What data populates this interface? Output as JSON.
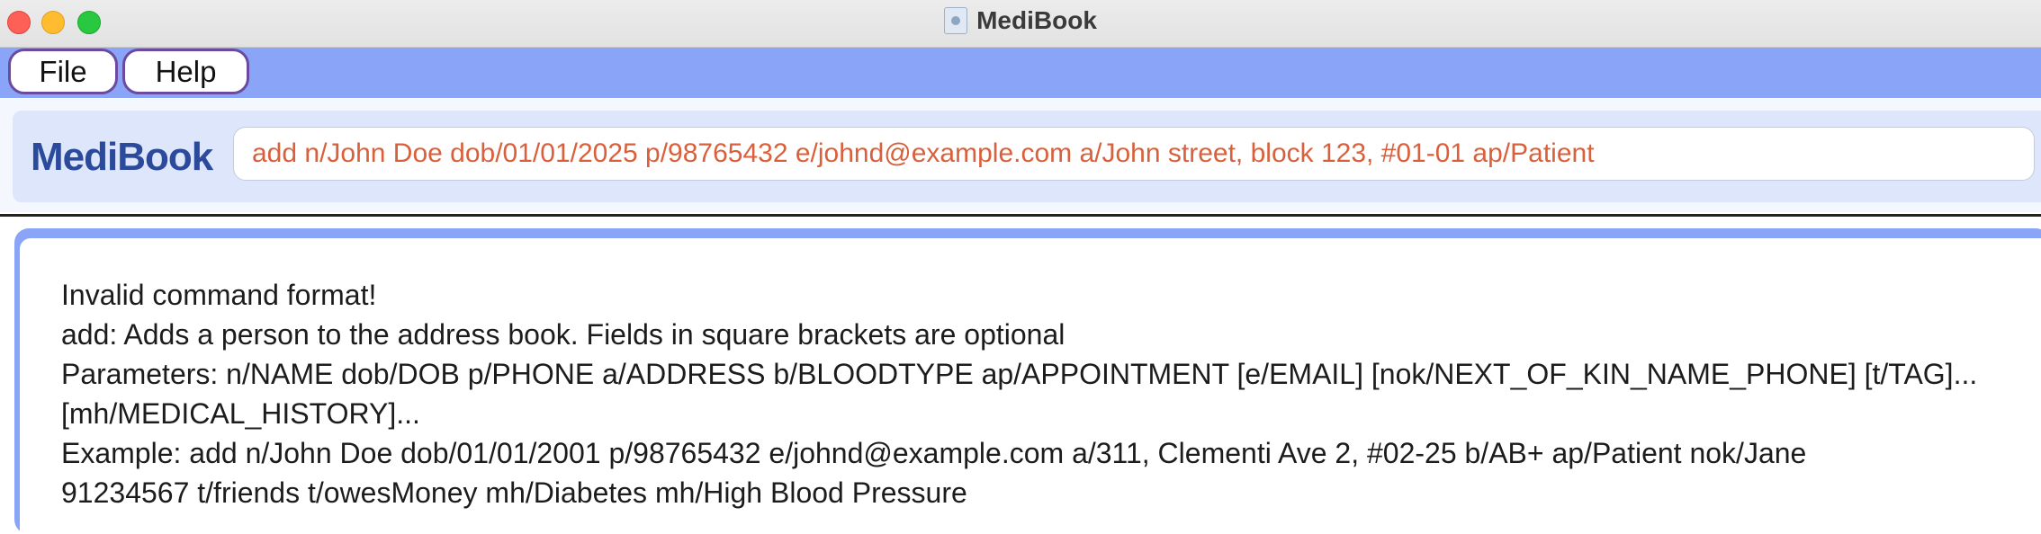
{
  "window": {
    "title": "MediBook",
    "traffic_lights": [
      "close",
      "minimize",
      "maximize"
    ],
    "app_icon": "app-icon"
  },
  "menu": {
    "items": [
      {
        "label": "File"
      },
      {
        "label": "Help"
      }
    ]
  },
  "command_box": {
    "brand": "MediBook",
    "value": "add n/John Doe dob/01/01/2025 p/98765432 e/johnd@example.com a/John street, block 123, #01-01 ap/Patient"
  },
  "result": {
    "lines": [
      "Invalid command format!",
      "add: Adds a person to the address book. Fields in square brackets are optional",
      "Parameters: n/NAME dob/DOB p/PHONE a/ADDRESS b/BLOODTYPE ap/APPOINTMENT [e/EMAIL] [nok/NEXT_OF_KIN_NAME_PHONE] [t/TAG]...",
      "[mh/MEDICAL_HISTORY]...",
      "Example: add n/John Doe dob/01/01/2001 p/98765432 e/johnd@example.com a/311, Clementi Ave 2, #02-25 b/AB+ ap/Patient nok/Jane",
      "91234567 t/friends t/owesMoney mh/Diabetes mh/High Blood Pressure"
    ]
  },
  "colors": {
    "menubar": "#8aa4f8",
    "brand": "#2c4a9c",
    "command_text": "#d9603b",
    "menu_border": "#6a4ba0"
  }
}
